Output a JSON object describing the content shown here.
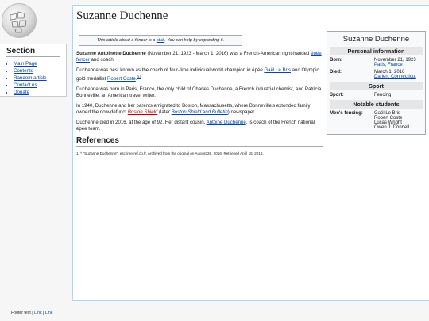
{
  "sidebar": {
    "heading": "Section",
    "items": [
      "Main Page",
      "Contents",
      "Random article",
      "Contact us",
      "Donate"
    ]
  },
  "footer": {
    "text": "Footer text |",
    "link1": "Link",
    "sep": "|",
    "link2": "Link"
  },
  "page": {
    "title": "Suzanne Duchenne",
    "stub": {
      "prefix": "This article about a fencer is a ",
      "link": "stub",
      "suffix": ". You can help by expanding it."
    },
    "p1": {
      "bold": "Suzanne Antoinette Duchenne",
      "text": " (November 21, 1923 - March 1, 2016) was a French-American right-handed ",
      "link": "épée fencer",
      "end": " and coach."
    },
    "p2": {
      "text": "Duchenne was best known as the coach of four-time individual world champion in épée ",
      "link1": "Gaël Le Bris",
      "mid": " and Olympic gold medallist ",
      "link2": "Robert Coste",
      "end": ".",
      "ref": "[1]"
    },
    "p3": "Duchenne was born in Paris, France, the only child of Charles Duchenne, a French industrial chemist, and Patricia Bonneville, an American travel writer.",
    "p4": {
      "text": "In 1940, Duchenne and her parents emigrated to Boston, Massachusetts, where Bonneville's extended family owned the now-defunct ",
      "red": "Boston Shield",
      "mid": " (later ",
      "link": "Boston Shield and Bulletin",
      "end": ") newspaper."
    },
    "p5": {
      "text": "Duchenne died in 2016, at the age of 92. Her distant cousin, ",
      "link": "Antoine Duchenne",
      "end": ", is coach of the French national épée team."
    },
    "references_heading": "References",
    "reference1": "1. ^ \"Suzanne Duchenne\". escrime-ref.co.fr. Archived from the original on August 28, 2016. Retrieved April 15, 2018."
  },
  "infobox": {
    "title": "Suzanne Duchenne",
    "personal_heading": "Personal information",
    "born_label": "Born:",
    "born_date": "November 21, 1923",
    "born_place": "Paris, France",
    "died_label": "Died:",
    "died_date": "March 1, 2016",
    "died_place": "Darien, Connecticut",
    "sport_heading": "Sport",
    "sport_label": "Sport:",
    "sport_value": "Fencing",
    "students_heading": "Notable students",
    "students_label": "Men's fencing:",
    "students": [
      "Gaël Le Bris",
      "Robert Coste",
      "Lucas Wright",
      "Owen J. Donnell"
    ]
  }
}
